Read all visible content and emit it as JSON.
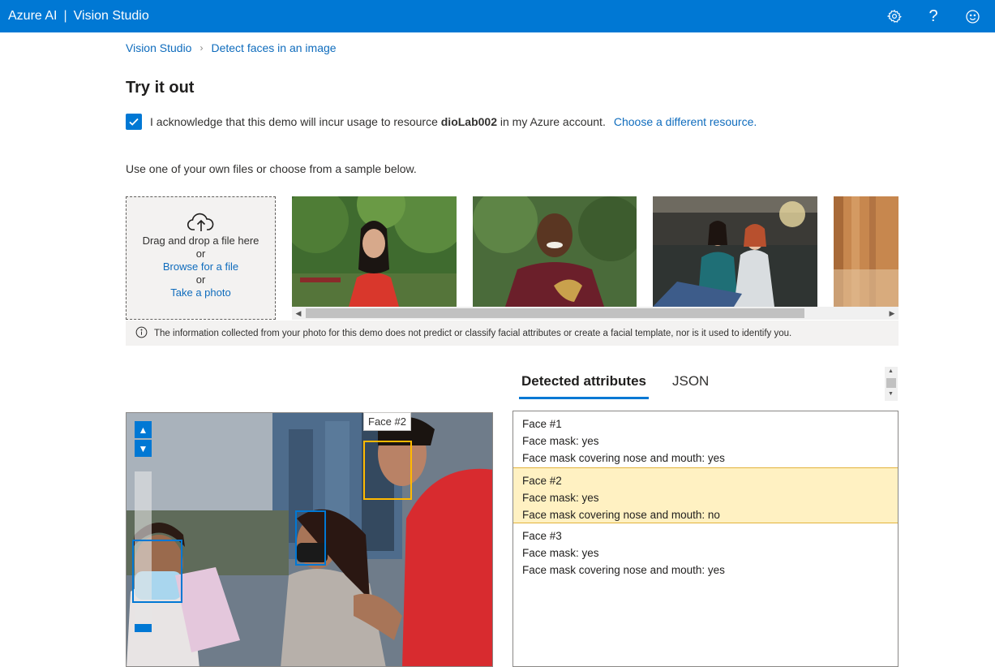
{
  "header": {
    "brand": "Azure AI",
    "separator": "|",
    "product": "Vision Studio",
    "icons": [
      "settings-icon",
      "help-icon",
      "feedback-icon"
    ],
    "help_glyph": "?"
  },
  "breadcrumb": {
    "root": "Vision Studio",
    "current": "Detect faces in an image"
  },
  "page_title": "Try it out",
  "acknowledge": {
    "checked": true,
    "text_before": "I acknowledge that this demo will incur usage to resource ",
    "resource": "dioLab002",
    "text_after": " in my Azure account.",
    "link": "Choose a different resource."
  },
  "instructions": "Use one of your own files or choose from a sample below.",
  "upload": {
    "drag_text": "Drag and drop a file here",
    "or1": "or",
    "browse": "Browse for a file",
    "or2": "or",
    "photo": "Take a photo"
  },
  "notice": "The information collected from your photo for this demo does not predict or classify facial attributes or create a facial template, nor is it used to identify you.",
  "tabs": [
    {
      "label": "Detected attributes",
      "active": true
    },
    {
      "label": "JSON",
      "active": false
    }
  ],
  "tooltip": "Face #2",
  "faces": [
    {
      "title": "Face #1",
      "mask": "Face mask: yes",
      "covering": "Face mask covering nose and mouth: yes",
      "selected": false
    },
    {
      "title": "Face #2",
      "mask": "Face mask: yes",
      "covering": "Face mask covering nose and mouth: no",
      "selected": true
    },
    {
      "title": "Face #3",
      "mask": "Face mask: yes",
      "covering": "Face mask covering nose and mouth: yes",
      "selected": false
    }
  ],
  "colors": {
    "accent": "#0078d4",
    "selected_face": "#ffb900",
    "selected_row": "#fff1c2"
  }
}
